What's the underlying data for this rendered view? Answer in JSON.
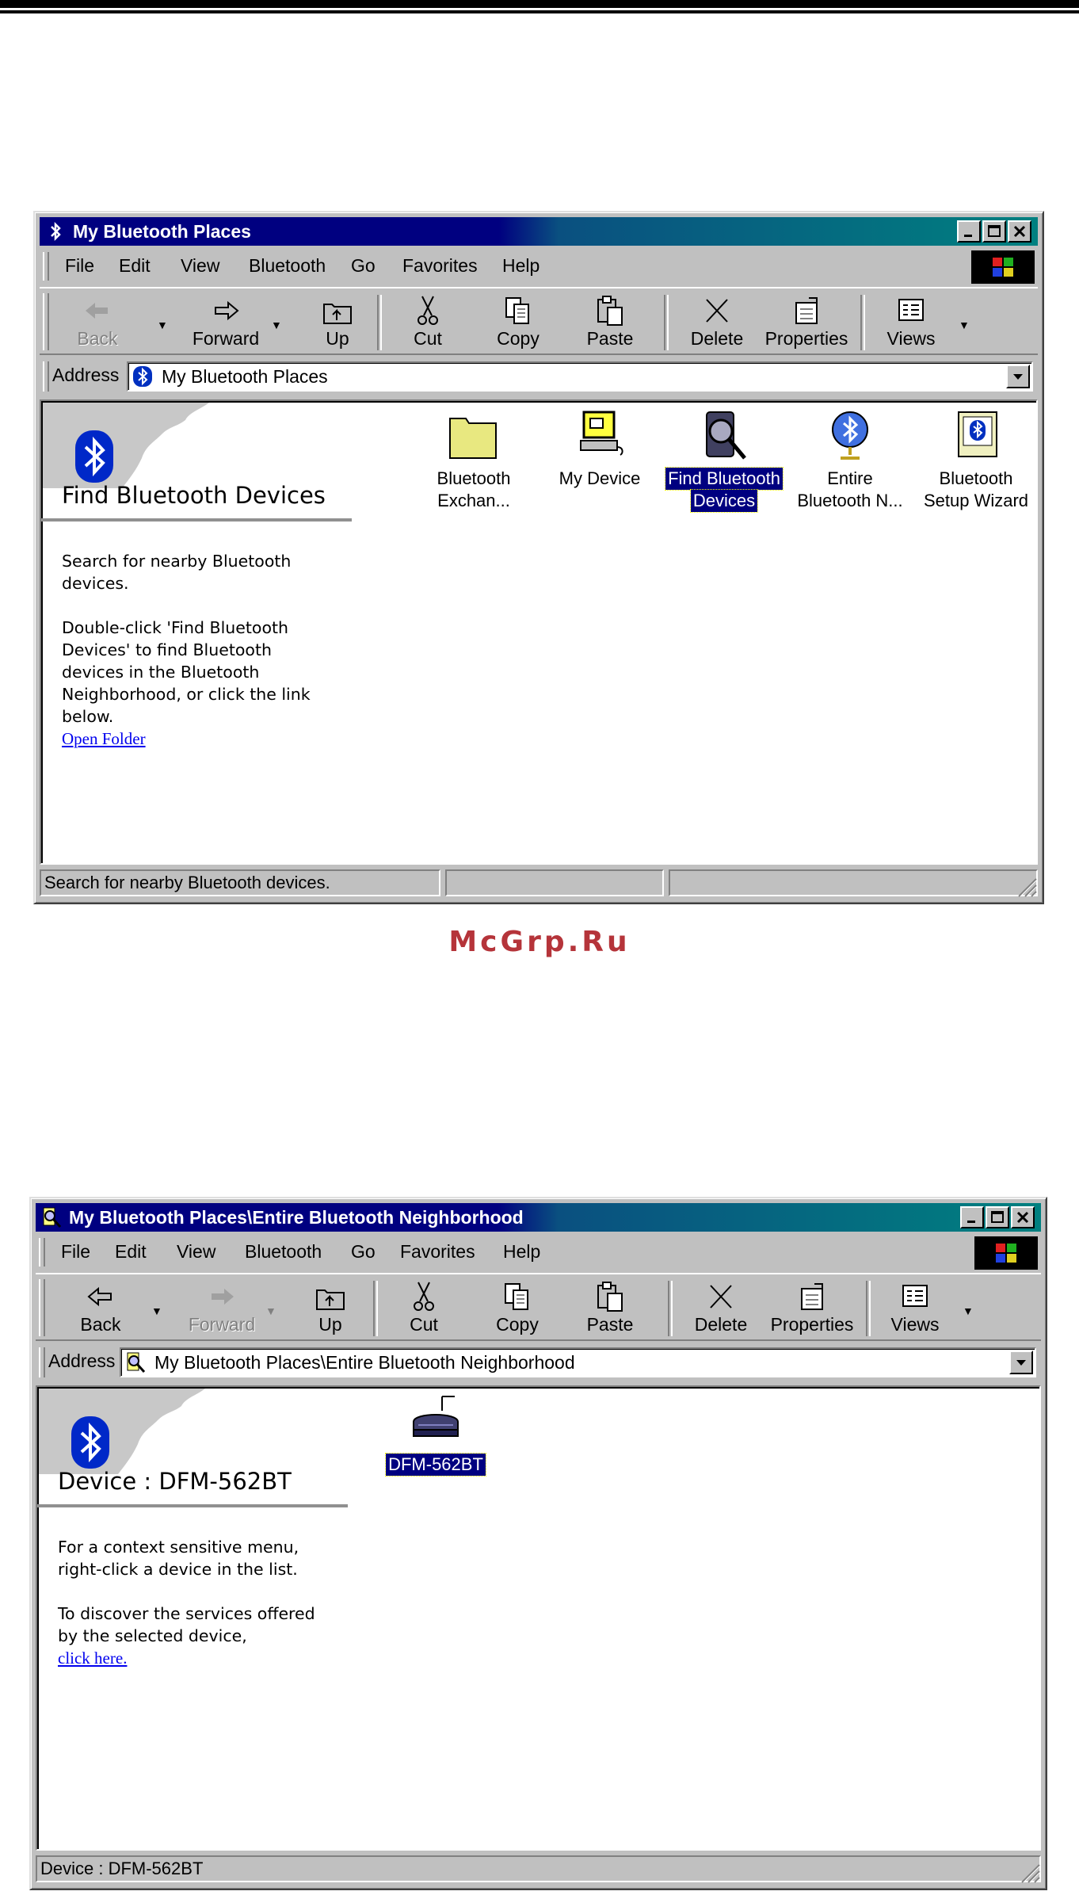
{
  "watermark": "McGrp.Ru",
  "window1": {
    "title": "My Bluetooth Places",
    "menu": [
      "File",
      "Edit",
      "View",
      "Bluetooth",
      "Go",
      "Favorites",
      "Help"
    ],
    "toolbar": {
      "back": "Back",
      "forward": "Forward",
      "up": "Up",
      "cut": "Cut",
      "copy": "Copy",
      "paste": "Paste",
      "delete": "Delete",
      "properties": "Properties",
      "views": "Views"
    },
    "address_label": "Address",
    "address_value": "My Bluetooth Places",
    "pane": {
      "title": "Find Bluetooth Devices",
      "text1": "Search for nearby Bluetooth devices.",
      "text2": "Double-click 'Find Bluetooth Devices' to find Bluetooth devices in the Bluetooth Neighborhood, or click the link below.",
      "link": "Open Folder"
    },
    "items": [
      {
        "line1": "Bluetooth",
        "line2": "Exchan...",
        "icon": "folder-icon"
      },
      {
        "line1": "My Device",
        "line2": "",
        "icon": "computer-icon"
      },
      {
        "line1": "Find Bluetooth",
        "line2": "Devices",
        "icon": "find-devices-icon",
        "selected": true
      },
      {
        "line1": "Entire",
        "line2": "Bluetooth N...",
        "icon": "globe-icon"
      },
      {
        "line1": "Bluetooth",
        "line2": "Setup Wizard",
        "icon": "wizard-icon"
      }
    ],
    "status": "Search for nearby Bluetooth devices."
  },
  "window2": {
    "title": "My Bluetooth Places\\Entire Bluetooth Neighborhood",
    "menu": [
      "File",
      "Edit",
      "View",
      "Bluetooth",
      "Go",
      "Favorites",
      "Help"
    ],
    "toolbar": {
      "back": "Back",
      "forward": "Forward",
      "up": "Up",
      "cut": "Cut",
      "copy": "Copy",
      "paste": "Paste",
      "delete": "Delete",
      "properties": "Properties",
      "views": "Views"
    },
    "address_label": "Address",
    "address_value": "My Bluetooth Places\\Entire Bluetooth Neighborhood",
    "pane": {
      "title": "Device : DFM-562BT",
      "text1": "For a context sensitive menu, right-click a device in the list.",
      "text2": "To discover the services offered by the selected device,",
      "link": "click here."
    },
    "items": [
      {
        "line1": "DFM-562BT",
        "icon": "modem-icon",
        "selected": true
      }
    ],
    "status": "Device : DFM-562BT"
  }
}
